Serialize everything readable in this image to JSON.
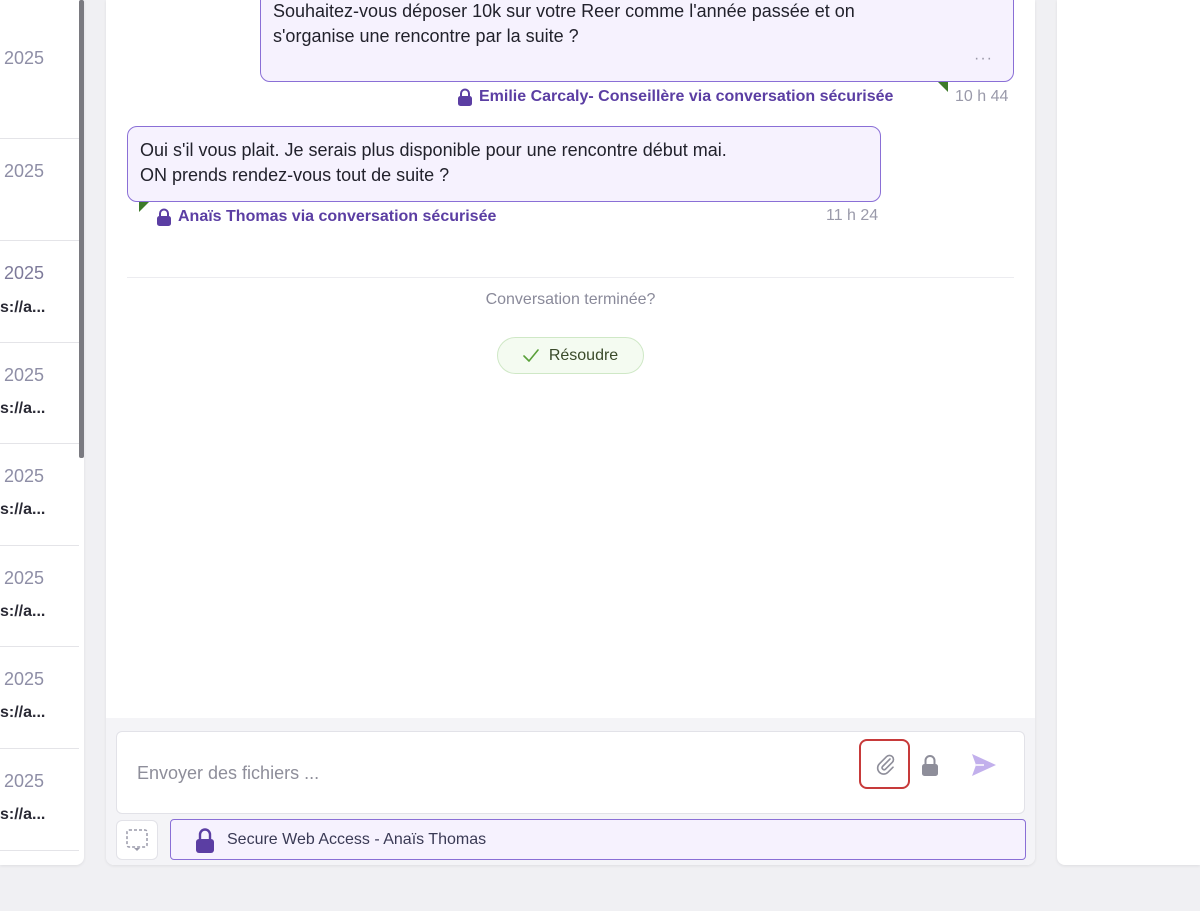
{
  "left_list": {
    "items": [
      {
        "date": ". 2025",
        "link": ""
      },
      {
        "date": ". 2025",
        "link": ""
      },
      {
        "date": ". 2025",
        "link": "s://a..."
      },
      {
        "date": ". 2025",
        "link": "s://a..."
      },
      {
        "date": ". 2025",
        "link": "s://a..."
      },
      {
        "date": ". 2025",
        "link": "s://a..."
      },
      {
        "date": ". 2025",
        "link": "s://a..."
      },
      {
        "date": ". 2025",
        "link": "s://a..."
      }
    ]
  },
  "messages": {
    "outgoing": {
      "line1": "Souhaitez-vous déposer 10k sur votre Reer comme l'année passée et on",
      "line2": "s'organise une rencontre par la suite ?",
      "more": "···",
      "sender": "Emilie Carcaly- Conseillère via conversation sécurisée",
      "time": "10 h 44"
    },
    "incoming": {
      "line1": "Oui s'il vous plait. Je serais plus disponible pour une rencontre début mai.",
      "line2": "ON prends rendez-vous tout de suite ?",
      "sender": "Anaïs Thomas via conversation sécurisée",
      "time": "11 h 24"
    }
  },
  "resolve": {
    "question": "Conversation terminée?",
    "button_label": "Résoudre"
  },
  "composer": {
    "placeholder": "Envoyer des fichiers ..."
  },
  "channel": {
    "label": "Secure Web Access - Anaïs Thomas"
  },
  "colors": {
    "accent": "#5b3ea3",
    "bubble_border": "#8a6fd6",
    "bubble_bg": "#f6f2fe",
    "highlight": "#c73a3a",
    "resolve_green": "#5aa03a"
  }
}
